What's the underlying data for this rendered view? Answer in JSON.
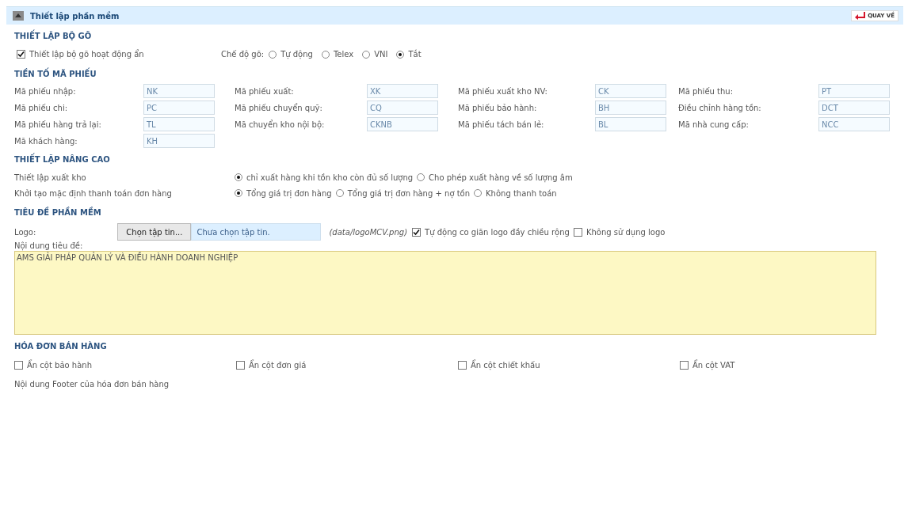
{
  "header": {
    "title": "Thiết lập phần mềm",
    "back_button": "QUAY VỀ"
  },
  "input_section": {
    "title": "THIẾT LẬP BỘ GÕ",
    "hidden_option": {
      "label": "Thiết lập bộ gõ hoạt động ẩn",
      "checked": true
    },
    "mode_label": "Chế độ gõ:",
    "modes": [
      {
        "label": "Tự động",
        "selected": false
      },
      {
        "label": "Telex",
        "selected": false
      },
      {
        "label": "VNI",
        "selected": false
      },
      {
        "label": "Tắt",
        "selected": true
      }
    ]
  },
  "prefix_section": {
    "title": "TIỀN TỐ MÃ PHIẾU",
    "fields": [
      {
        "label": "Mã phiếu nhập:",
        "value": "NK"
      },
      {
        "label": "Mã phiếu xuất:",
        "value": "XK"
      },
      {
        "label": "Mã phiếu xuất kho NV:",
        "value": "CK"
      },
      {
        "label": "Mã phiếu thu:",
        "value": "PT"
      },
      {
        "label": "Mã phiếu chi:",
        "value": "PC"
      },
      {
        "label": "Mã phiếu chuyển quỹ:",
        "value": "CQ"
      },
      {
        "label": "Mã phiếu bảo hành:",
        "value": "BH"
      },
      {
        "label": "Điều chỉnh hàng tồn:",
        "value": "DCT"
      },
      {
        "label": "Mã phiếu hàng trả lại:",
        "value": "TL"
      },
      {
        "label": "Mã chuyển kho nội bộ:",
        "value": "CKNB"
      },
      {
        "label": "Mã phiếu tách bán lẻ:",
        "value": "BL"
      },
      {
        "label": "Mã nhà cung cấp:",
        "value": "NCC"
      },
      {
        "label": "Mã khách hàng:",
        "value": "KH"
      }
    ]
  },
  "advanced_section": {
    "title": "THIẾT LẬP NÂNG CAO",
    "rows": [
      {
        "label": "Thiết lập xuất kho",
        "options": [
          {
            "label": "chỉ xuất hàng khi tồn kho còn đủ số lượng",
            "selected": true
          },
          {
            "label": "Cho phép xuất hàng về số lượng âm",
            "selected": false
          }
        ]
      },
      {
        "label": "Khởi tạo mặc định thanh toán đơn hàng",
        "options": [
          {
            "label": "Tổng giá trị đơn hàng",
            "selected": true
          },
          {
            "label": "Tổng giá trị đơn hàng + nợ tồn",
            "selected": false
          },
          {
            "label": "Không thanh toán",
            "selected": false
          }
        ]
      }
    ]
  },
  "title_section": {
    "title": "TIÊU ĐỀ PHẦN MỀM",
    "logo_label": "Logo:",
    "file_button": "Chọn tập tin...",
    "file_status": "Chưa chọn tập tin.",
    "logo_path": "(data/logoMCV.png)",
    "options": [
      {
        "label": "Tự động co giãn logo đầy chiều rộng",
        "checked": true
      },
      {
        "label": "Không sử dụng logo",
        "checked": false
      }
    ],
    "content_label": "Nội dung tiêu đề:",
    "content_value": "AMS GIẢI PHÁP QUẢN LÝ VÀ ĐIỀU HÀNH DOANH NGHIỆP"
  },
  "invoice_section": {
    "title": "HÓA ĐƠN BÁN HÀNG",
    "options": [
      {
        "label": "Ẩn cột bảo hành",
        "checked": false
      },
      {
        "label": "Ẩn cột đơn giá",
        "checked": false
      },
      {
        "label": "Ẩn cột chiết khấu",
        "checked": false
      },
      {
        "label": "Ẩn cột VAT",
        "checked": false
      }
    ],
    "footer_label": "Nội dung Footer của hóa đơn bán hàng"
  }
}
